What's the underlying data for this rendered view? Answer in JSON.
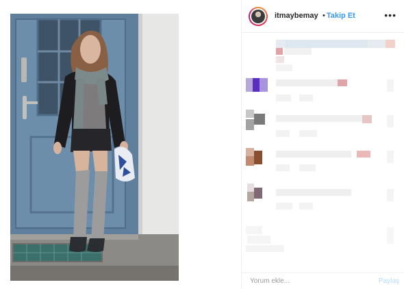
{
  "post": {
    "username": "itmaybemay",
    "separator": "•",
    "follow_label": "Takip Et",
    "more_icon": "more-horizontal-icon"
  },
  "comment_form": {
    "placeholder": "Yorum ekle...",
    "submit_label": "Paylaş"
  },
  "colors": {
    "link_blue": "#3897f0",
    "share_disabled": "#b3dbff",
    "border": "#efefef"
  }
}
